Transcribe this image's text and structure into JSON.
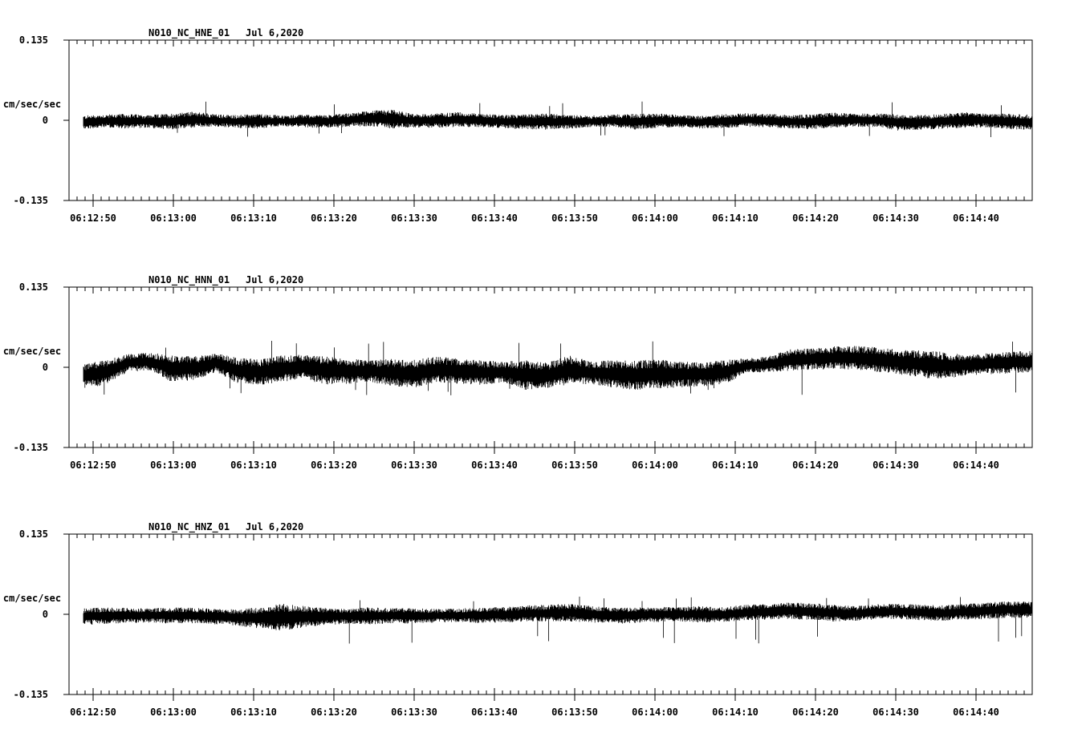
{
  "chart_data": [
    {
      "type": "line",
      "title": "N010_NC_HNE_01",
      "date": "Jul 6,2020",
      "ylabel": "cm/sec/sec",
      "ylim": [
        -0.135,
        0.135
      ],
      "ytick_labels": [
        "0.135",
        "0",
        "-0.135"
      ],
      "xlim": [
        "06:12:47",
        "06:14:47"
      ],
      "xtick_labels": [
        "06:12:50",
        "06:13:00",
        "06:13:10",
        "06:13:20",
        "06:13:30",
        "06:13:40",
        "06:13:50",
        "06:14:00",
        "06:14:10",
        "06:14:20",
        "06:14:30",
        "06:14:40"
      ],
      "series": [
        {
          "color": "#000000",
          "x_start": "06:12:48.8",
          "x_end": "06:14:47",
          "envelope_max": [
            0.008,
            0.01,
            0.011,
            0.009,
            0.012,
            0.015,
            0.01,
            0.009,
            0.011,
            0.008,
            0.01,
            0.009,
            0.012,
            0.016,
            0.018,
            0.01,
            0.012,
            0.014,
            0.011,
            0.009,
            0.01,
            0.012,
            0.009,
            0.008,
            0.01,
            0.011,
            0.012,
            0.009,
            0.008,
            0.01,
            0.012,
            0.011,
            0.009,
            0.01,
            0.013,
            0.011,
            0.012,
            0.01,
            0.009,
            0.011,
            0.014,
            0.012,
            0.011,
            0.01
          ],
          "envelope_min": [
            -0.015,
            -0.012,
            -0.014,
            -0.013,
            -0.016,
            -0.012,
            -0.011,
            -0.013,
            -0.014,
            -0.01,
            -0.012,
            -0.013,
            -0.011,
            -0.01,
            -0.014,
            -0.012,
            -0.013,
            -0.011,
            -0.012,
            -0.013,
            -0.015,
            -0.016,
            -0.014,
            -0.012,
            -0.011,
            -0.016,
            -0.013,
            -0.012,
            -0.014,
            -0.013,
            -0.011,
            -0.012,
            -0.014,
            -0.015,
            -0.013,
            -0.011,
            -0.012,
            -0.018,
            -0.016,
            -0.014,
            -0.013,
            -0.012,
            -0.015,
            -0.016
          ],
          "peak_max": 0.032,
          "peak_min": -0.03
        }
      ]
    },
    {
      "type": "line",
      "title": "N010_NC_HNN_01",
      "date": "Jul 6,2020",
      "ylabel": "cm/sec/sec",
      "ylim": [
        -0.135,
        0.135
      ],
      "ytick_labels": [
        "0.135",
        "0",
        "-0.135"
      ],
      "xlim": [
        "06:12:47",
        "06:14:47"
      ],
      "xtick_labels": [
        "06:12:50",
        "06:13:00",
        "06:13:10",
        "06:13:20",
        "06:13:30",
        "06:13:40",
        "06:13:50",
        "06:14:00",
        "06:14:10",
        "06:14:20",
        "06:14:30",
        "06:14:40"
      ],
      "series": [
        {
          "color": "#000000",
          "x_start": "06:12:48.8",
          "x_end": "06:14:47",
          "envelope_max": [
            0.006,
            0.012,
            0.022,
            0.025,
            0.02,
            0.018,
            0.024,
            0.016,
            0.014,
            0.02,
            0.022,
            0.018,
            0.015,
            0.012,
            0.014,
            0.013,
            0.018,
            0.016,
            0.012,
            0.01,
            0.012,
            0.008,
            0.02,
            0.01,
            0.012,
            0.011,
            0.014,
            0.01,
            0.008,
            0.012,
            0.015,
            0.018,
            0.03,
            0.032,
            0.035,
            0.036,
            0.034,
            0.03,
            0.028,
            0.026,
            0.02,
            0.024,
            0.026,
            0.028
          ],
          "envelope_min": [
            -0.035,
            -0.03,
            -0.008,
            -0.005,
            -0.025,
            -0.022,
            -0.008,
            -0.028,
            -0.03,
            -0.025,
            -0.02,
            -0.03,
            -0.028,
            -0.025,
            -0.032,
            -0.035,
            -0.025,
            -0.028,
            -0.03,
            -0.026,
            -0.038,
            -0.035,
            -0.03,
            -0.028,
            -0.034,
            -0.038,
            -0.036,
            -0.034,
            -0.032,
            -0.03,
            -0.01,
            -0.008,
            -0.006,
            -0.004,
            -0.003,
            -0.004,
            -0.008,
            -0.012,
            -0.018,
            -0.02,
            -0.014,
            -0.012,
            -0.01,
            -0.008
          ],
          "peak_max": 0.045,
          "peak_min": -0.05
        }
      ]
    },
    {
      "type": "line",
      "title": "N010_NC_HNZ_01",
      "date": "Jul 6,2020",
      "ylabel": "cm/sec/sec",
      "ylim": [
        -0.135,
        0.135
      ],
      "ytick_labels": [
        "0.135",
        "0",
        "-0.135"
      ],
      "xlim": [
        "06:12:47",
        "06:14:47"
      ],
      "xtick_labels": [
        "06:12:50",
        "06:13:00",
        "06:13:10",
        "06:13:20",
        "06:13:30",
        "06:13:40",
        "06:13:50",
        "06:14:00",
        "06:14:10",
        "06:14:20",
        "06:14:30",
        "06:14:40"
      ],
      "series": [
        {
          "color": "#000000",
          "x_start": "06:12:48.8",
          "x_end": "06:14:47",
          "envelope_max": [
            0.01,
            0.012,
            0.011,
            0.01,
            0.012,
            0.011,
            0.01,
            0.009,
            0.012,
            0.018,
            0.014,
            0.011,
            0.01,
            0.012,
            0.011,
            0.01,
            0.009,
            0.01,
            0.011,
            0.012,
            0.015,
            0.016,
            0.018,
            0.014,
            0.012,
            0.011,
            0.013,
            0.012,
            0.014,
            0.012,
            0.016,
            0.018,
            0.02,
            0.019,
            0.016,
            0.014,
            0.017,
            0.018,
            0.016,
            0.015,
            0.018,
            0.02,
            0.022,
            0.021
          ],
          "envelope_min": [
            -0.018,
            -0.016,
            -0.015,
            -0.014,
            -0.016,
            -0.015,
            -0.017,
            -0.02,
            -0.024,
            -0.028,
            -0.022,
            -0.018,
            -0.016,
            -0.017,
            -0.015,
            -0.016,
            -0.014,
            -0.013,
            -0.015,
            -0.014,
            -0.012,
            -0.013,
            -0.012,
            -0.014,
            -0.016,
            -0.015,
            -0.013,
            -0.012,
            -0.014,
            -0.013,
            -0.01,
            -0.009,
            -0.008,
            -0.01,
            -0.012,
            -0.011,
            -0.009,
            -0.008,
            -0.01,
            -0.011,
            -0.009,
            -0.008,
            -0.006,
            -0.007
          ],
          "peak_max": 0.03,
          "peak_min": -0.052
        }
      ]
    }
  ]
}
